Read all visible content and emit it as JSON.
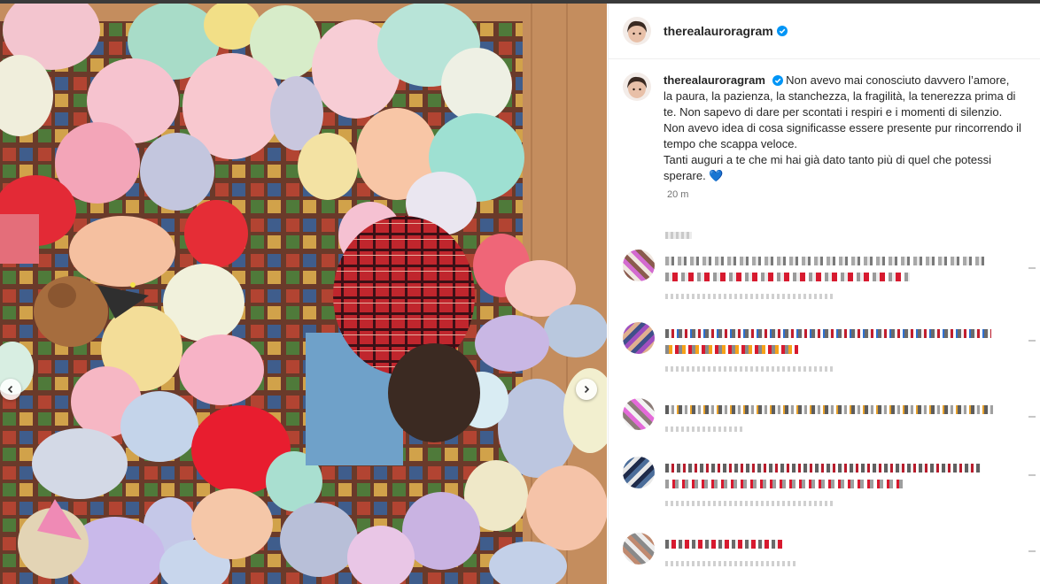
{
  "post": {
    "username": "therealauroragram",
    "caption_line1": "Non avevo mai conosciuto davvero l’amore, la paura, la pazienza, la stanchezza, la fragilità, la tenerezza prima di te. Non sapevo di dare per scontati i respiri e i momenti di silenzio. Non avevo idea di cosa significasse essere presente pur rincorrendo il tempo che scappa veloce.",
    "caption_line2": "Tanti auguri a te che mi hai già dato tanto più di quel che potessi sperare. 💙",
    "timestamp": "20 m"
  },
  "icons": {
    "verified": "verified-badge-icon",
    "prev": "chevron-left-icon",
    "next": "chevron-right-icon"
  },
  "colors": {
    "verified": "#0095f6",
    "text": "#262626",
    "muted": "#737373"
  }
}
